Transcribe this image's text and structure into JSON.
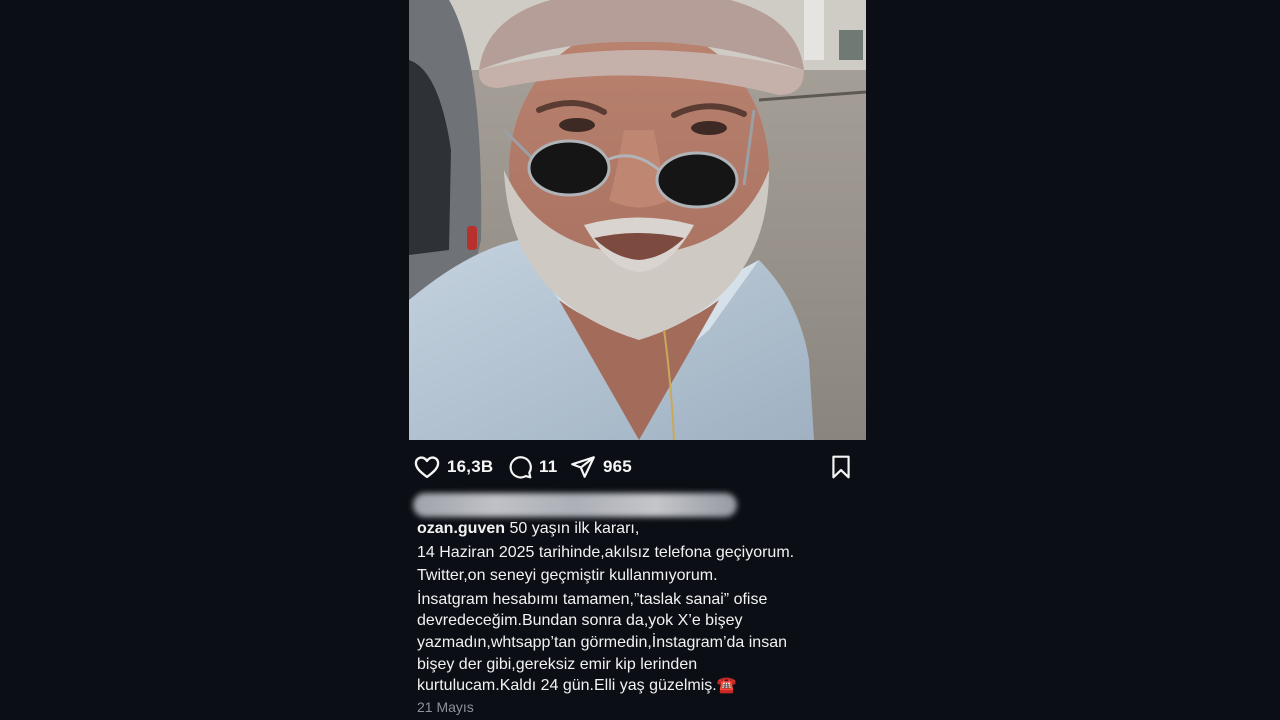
{
  "post": {
    "username": "ozan.guven",
    "caption_lines": [
      "50 yaşın ilk kararı,",
      "14 Haziran 2025 tarihinde,akılsız telefona geçiyorum.",
      "Twitter,on seneyi geçmiştir kullanmıyorum.",
      "İnsatgram hesabımı tamamen,”taslak sanai” ofise",
      "devredeceğim.Bundan sonra da,yok X’e bişey",
      "yazmadın,whtsapp’tan görmedin,İnstagram’da insan",
      "bişey der gibi,gereksiz emir kip lerinden",
      "kurtulucam.Kaldı 24 gün.Elli yaş güzelmiş.☎️"
    ],
    "date": "21 Mayıs"
  },
  "actions": {
    "likes": "16,3B",
    "comments": "11",
    "shares": "965",
    "like_icon": "heart-icon",
    "comment_icon": "comment-bubble-icon",
    "share_icon": "paper-plane-icon",
    "save_icon": "bookmark-icon"
  },
  "colors": {
    "background": "#0b0e14",
    "text": "#f2f2f2",
    "muted": "#8e929a"
  }
}
